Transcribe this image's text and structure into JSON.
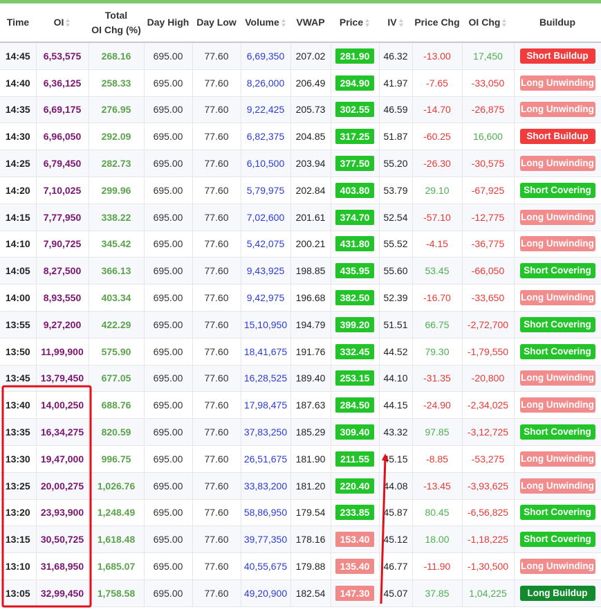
{
  "colors": {
    "top_bar": "#7cc86a",
    "oi_text": "#7a1470",
    "total_oi_text": "#5aa34a",
    "volume_text": "#2b3bd1",
    "price_up_bg": "#22c42a",
    "price_down_bg": "#f08a89",
    "negative_text": "#e53935",
    "positive_text": "#4caf50",
    "short_buildup": "#f03c3c",
    "long_unwinding": "#f28c8c",
    "short_covering": "#22c42a",
    "long_buildup": "#138a2e",
    "annotation": "#e0101a"
  },
  "table": {
    "headers": {
      "time": "Time",
      "oi": "OI",
      "total_oi_line1": "Total",
      "total_oi_line2": "OI Chg (%)",
      "day_high": "Day High",
      "day_low": "Day Low",
      "volume": "Volume",
      "vwap": "VWAP",
      "price": "Price",
      "iv": "IV",
      "price_chg": "Price Chg",
      "oi_chg": "OI Chg",
      "buildup": "Buildup"
    },
    "rows": [
      {
        "time": "14:45",
        "oi": "6,53,575",
        "total_oi": "268.16",
        "day_high": "695.00",
        "day_low": "77.60",
        "volume": "6,69,350",
        "vwap": "207.02",
        "price": "281.90",
        "price_dir": "up",
        "iv": "46.32",
        "price_chg": "-13.00",
        "oi_chg": "17,450",
        "buildup": "Short Buildup",
        "buildup_type": "sb"
      },
      {
        "time": "14:40",
        "oi": "6,36,125",
        "total_oi": "258.33",
        "day_high": "695.00",
        "day_low": "77.60",
        "volume": "8,26,000",
        "vwap": "206.49",
        "price": "294.90",
        "price_dir": "up",
        "iv": "41.97",
        "price_chg": "-7.65",
        "oi_chg": "-33,050",
        "buildup": "Long Unwinding",
        "buildup_type": "lu"
      },
      {
        "time": "14:35",
        "oi": "6,69,175",
        "total_oi": "276.95",
        "day_high": "695.00",
        "day_low": "77.60",
        "volume": "9,22,425",
        "vwap": "205.73",
        "price": "302.55",
        "price_dir": "up",
        "iv": "46.59",
        "price_chg": "-14.70",
        "oi_chg": "-26,875",
        "buildup": "Long Unwinding",
        "buildup_type": "lu"
      },
      {
        "time": "14:30",
        "oi": "6,96,050",
        "total_oi": "292.09",
        "day_high": "695.00",
        "day_low": "77.60",
        "volume": "6,82,375",
        "vwap": "204.85",
        "price": "317.25",
        "price_dir": "up",
        "iv": "51.87",
        "price_chg": "-60.25",
        "oi_chg": "16,600",
        "buildup": "Short Buildup",
        "buildup_type": "sb"
      },
      {
        "time": "14:25",
        "oi": "6,79,450",
        "total_oi": "282.73",
        "day_high": "695.00",
        "day_low": "77.60",
        "volume": "6,10,500",
        "vwap": "203.94",
        "price": "377.50",
        "price_dir": "up",
        "iv": "55.20",
        "price_chg": "-26.30",
        "oi_chg": "-30,575",
        "buildup": "Long Unwinding",
        "buildup_type": "lu"
      },
      {
        "time": "14:20",
        "oi": "7,10,025",
        "total_oi": "299.96",
        "day_high": "695.00",
        "day_low": "77.60",
        "volume": "5,79,975",
        "vwap": "202.84",
        "price": "403.80",
        "price_dir": "up",
        "iv": "53.79",
        "price_chg": "29.10",
        "oi_chg": "-67,925",
        "buildup": "Short Covering",
        "buildup_type": "sc"
      },
      {
        "time": "14:15",
        "oi": "7,77,950",
        "total_oi": "338.22",
        "day_high": "695.00",
        "day_low": "77.60",
        "volume": "7,02,600",
        "vwap": "201.61",
        "price": "374.70",
        "price_dir": "up",
        "iv": "52.54",
        "price_chg": "-57.10",
        "oi_chg": "-12,775",
        "buildup": "Long Unwinding",
        "buildup_type": "lu"
      },
      {
        "time": "14:10",
        "oi": "7,90,725",
        "total_oi": "345.42",
        "day_high": "695.00",
        "day_low": "77.60",
        "volume": "5,42,075",
        "vwap": "200.21",
        "price": "431.80",
        "price_dir": "up",
        "iv": "55.52",
        "price_chg": "-4.15",
        "oi_chg": "-36,775",
        "buildup": "Long Unwinding",
        "buildup_type": "lu"
      },
      {
        "time": "14:05",
        "oi": "8,27,500",
        "total_oi": "366.13",
        "day_high": "695.00",
        "day_low": "77.60",
        "volume": "9,43,925",
        "vwap": "198.85",
        "price": "435.95",
        "price_dir": "up",
        "iv": "55.60",
        "price_chg": "53.45",
        "oi_chg": "-66,050",
        "buildup": "Short Covering",
        "buildup_type": "sc"
      },
      {
        "time": "14:00",
        "oi": "8,93,550",
        "total_oi": "403.34",
        "day_high": "695.00",
        "day_low": "77.60",
        "volume": "9,42,975",
        "vwap": "196.68",
        "price": "382.50",
        "price_dir": "up",
        "iv": "52.39",
        "price_chg": "-16.70",
        "oi_chg": "-33,650",
        "buildup": "Long Unwinding",
        "buildup_type": "lu"
      },
      {
        "time": "13:55",
        "oi": "9,27,200",
        "total_oi": "422.29",
        "day_high": "695.00",
        "day_low": "77.60",
        "volume": "15,10,950",
        "vwap": "194.79",
        "price": "399.20",
        "price_dir": "up",
        "iv": "51.51",
        "price_chg": "66.75",
        "oi_chg": "-2,72,700",
        "buildup": "Short Covering",
        "buildup_type": "sc"
      },
      {
        "time": "13:50",
        "oi": "11,99,900",
        "total_oi": "575.90",
        "day_high": "695.00",
        "day_low": "77.60",
        "volume": "18,41,675",
        "vwap": "191.76",
        "price": "332.45",
        "price_dir": "up",
        "iv": "44.52",
        "price_chg": "79.30",
        "oi_chg": "-1,79,550",
        "buildup": "Short Covering",
        "buildup_type": "sc"
      },
      {
        "time": "13:45",
        "oi": "13,79,450",
        "total_oi": "677.05",
        "day_high": "695.00",
        "day_low": "77.60",
        "volume": "16,28,525",
        "vwap": "189.40",
        "price": "253.15",
        "price_dir": "up",
        "iv": "44.10",
        "price_chg": "-31.35",
        "oi_chg": "-20,800",
        "buildup": "Long Unwinding",
        "buildup_type": "lu"
      },
      {
        "time": "13:40",
        "oi": "14,00,250",
        "total_oi": "688.76",
        "day_high": "695.00",
        "day_low": "77.60",
        "volume": "17,98,475",
        "vwap": "187.63",
        "price": "284.50",
        "price_dir": "up",
        "iv": "44.15",
        "price_chg": "-24.90",
        "oi_chg": "-2,34,025",
        "buildup": "Long Unwinding",
        "buildup_type": "lu"
      },
      {
        "time": "13:35",
        "oi": "16,34,275",
        "total_oi": "820.59",
        "day_high": "695.00",
        "day_low": "77.60",
        "volume": "37,83,250",
        "vwap": "185.29",
        "price": "309.40",
        "price_dir": "up",
        "iv": "43.32",
        "price_chg": "97.85",
        "oi_chg": "-3,12,725",
        "buildup": "Short Covering",
        "buildup_type": "sc"
      },
      {
        "time": "13:30",
        "oi": "19,47,000",
        "total_oi": "996.75",
        "day_high": "695.00",
        "day_low": "77.60",
        "volume": "26,51,675",
        "vwap": "181.90",
        "price": "211.55",
        "price_dir": "up",
        "iv": "45.15",
        "price_chg": "-8.85",
        "oi_chg": "-53,275",
        "buildup": "Long Unwinding",
        "buildup_type": "lu"
      },
      {
        "time": "13:25",
        "oi": "20,00,275",
        "total_oi": "1,026.76",
        "day_high": "695.00",
        "day_low": "77.60",
        "volume": "33,83,200",
        "vwap": "181.20",
        "price": "220.40",
        "price_dir": "up",
        "iv": "44.08",
        "price_chg": "-13.45",
        "oi_chg": "-3,93,625",
        "buildup": "Long Unwinding",
        "buildup_type": "lu"
      },
      {
        "time": "13:20",
        "oi": "23,93,900",
        "total_oi": "1,248.49",
        "day_high": "695.00",
        "day_low": "77.60",
        "volume": "58,86,950",
        "vwap": "179.54",
        "price": "233.85",
        "price_dir": "up",
        "iv": "45.87",
        "price_chg": "80.45",
        "oi_chg": "-6,56,825",
        "buildup": "Short Covering",
        "buildup_type": "sc"
      },
      {
        "time": "13:15",
        "oi": "30,50,725",
        "total_oi": "1,618.48",
        "day_high": "695.00",
        "day_low": "77.60",
        "volume": "39,77,350",
        "vwap": "178.16",
        "price": "153.40",
        "price_dir": "down",
        "iv": "45.12",
        "price_chg": "18.00",
        "oi_chg": "-1,18,225",
        "buildup": "Short Covering",
        "buildup_type": "sc"
      },
      {
        "time": "13:10",
        "oi": "31,68,950",
        "total_oi": "1,685.07",
        "day_high": "695.00",
        "day_low": "77.60",
        "volume": "40,55,675",
        "vwap": "179.88",
        "price": "135.40",
        "price_dir": "down",
        "iv": "46.77",
        "price_chg": "-11.90",
        "oi_chg": "-1,30,500",
        "buildup": "Long Unwinding",
        "buildup_type": "lu"
      },
      {
        "time": "13:05",
        "oi": "32,99,450",
        "total_oi": "1,758.58",
        "day_high": "695.00",
        "day_low": "77.60",
        "volume": "49,20,900",
        "vwap": "182.54",
        "price": "147.30",
        "price_dir": "down",
        "iv": "45.07",
        "price_chg": "37.85",
        "oi_chg": "1,04,225",
        "buildup": "Long Buildup",
        "buildup_type": "lb"
      }
    ]
  }
}
